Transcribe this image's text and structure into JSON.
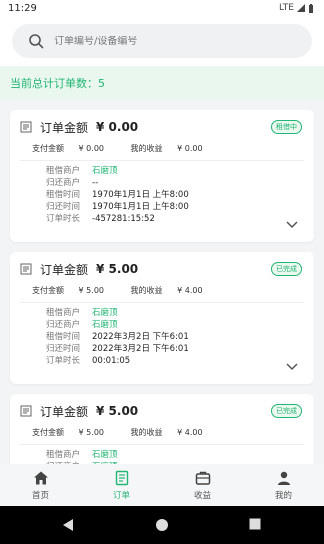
{
  "status": {
    "time": "11:29",
    "network": "LTE"
  },
  "search": {
    "placeholder": "订单编号/设备编号"
  },
  "summary": {
    "text": "当前总计订单数：5"
  },
  "labels": {
    "amount": "订单金额",
    "pay": "支付金额",
    "income": "我的收益",
    "rent_merchant": "租借商户",
    "return_merchant": "归还商户",
    "rent_time": "租借时间",
    "return_time": "归还时间",
    "duration": "订单时长"
  },
  "orders": [
    {
      "amount": "¥ 0.00",
      "status": "租借中",
      "pay": "¥ 0.00",
      "income": "¥ 0.00",
      "rent_merchant": "石磨顶",
      "return_merchant": "--",
      "rent_time": "1970年1月1日 上午8:00",
      "return_time": "1970年1月1日 上午8:00",
      "duration": "-457281:15:52"
    },
    {
      "amount": "¥ 5.00",
      "status": "已完成",
      "pay": "¥ 5.00",
      "income": "¥ 4.00",
      "rent_merchant": "石磨顶",
      "return_merchant": "石磨顶",
      "rent_time": "2022年3月2日 下午6:01",
      "return_time": "2022年3月2日 下午6:01",
      "duration": "00:01:05"
    },
    {
      "amount": "¥ 5.00",
      "status": "已完成",
      "pay": "¥ 5.00",
      "income": "¥ 4.00",
      "rent_merchant": "石磨顶",
      "return_merchant": "石磨顶"
    }
  ],
  "tabs": [
    {
      "label": "首页",
      "icon": "home-icon"
    },
    {
      "label": "订单",
      "icon": "orders-icon",
      "active": true
    },
    {
      "label": "收益",
      "icon": "wallet-icon"
    },
    {
      "label": "我的",
      "icon": "user-icon"
    }
  ],
  "colors": {
    "accent": "#22b573",
    "summary_bg": "#e9f7ef"
  }
}
